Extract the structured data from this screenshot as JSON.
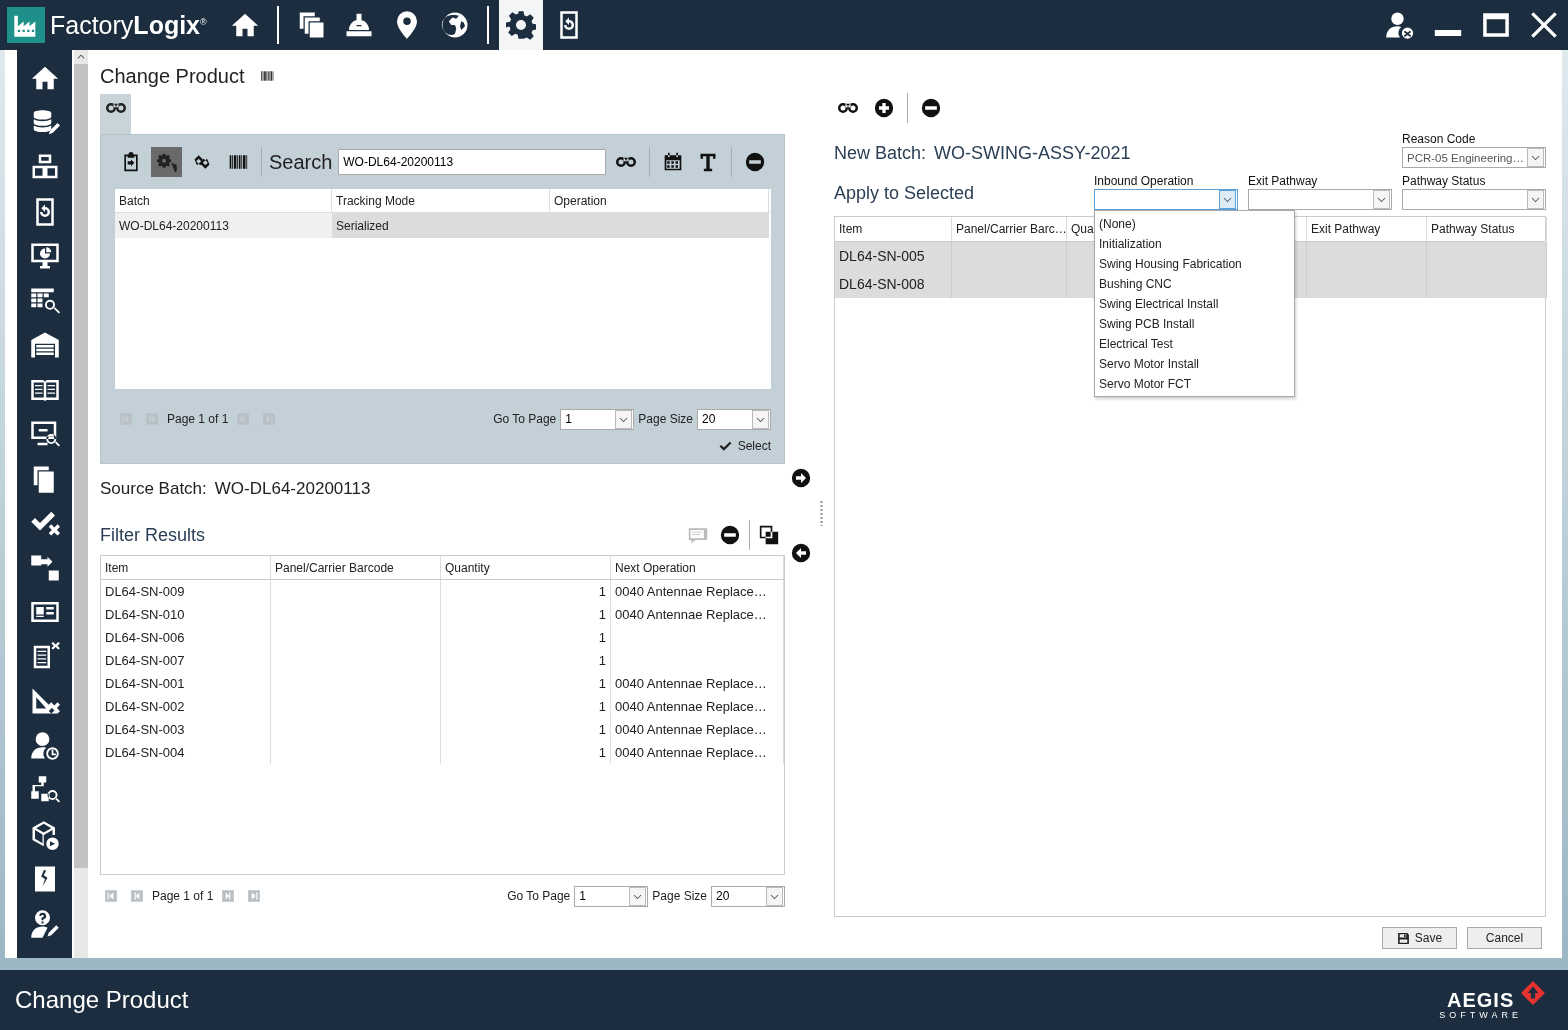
{
  "app": {
    "name": "Factory**Logix**$^{®}$"
  },
  "top_nav": [
    {
      "selected": false
    },
    {
      "selected": false
    },
    {
      "selected": false
    },
    {
      "selected": false
    },
    {
      "selected": false
    },
    {
      "selected": true
    },
    {
      "selected": false
    }
  ],
  "page": {
    "title": "Change Product"
  },
  "batch_search": {
    "tab": {
      "selected": true
    },
    "tools": [
      {
        "selected": false
      },
      {
        "selected": true
      },
      {
        "selected": false
      },
      {
        "selected": false
      }
    ],
    "search_label": "Search",
    "search_value": "WO-DL64-20200113",
    "columns": [
      "Batch",
      "Tracking Mode",
      "Operation"
    ],
    "rows": [
      {
        "cells": [
          "WO-DL64-20200113",
          "Serialized"
        ],
        "selected": true
      }
    ],
    "pager": {
      "page_info": "Page 1 of 1",
      "go_to_label": "Go To Page",
      "go_to_value": "1",
      "size_label": "Page Size",
      "size_value": "20"
    },
    "select_button": "Select"
  },
  "source": {
    "label": "Source Batch:",
    "value": "WO-DL64-20200113",
    "filter_title": "Filter Results",
    "columns": [
      "Item",
      "Panel/Carrier Barcode",
      "Quantity",
      "Next Operation"
    ],
    "rows": [
      {
        "item": "DL64-SN-009",
        "quantity": "1",
        "next_operation": "0040 Antennae Replace…"
      },
      {
        "item": "DL64-SN-010",
        "quantity": "1",
        "next_operation": "0040 Antennae Replace…"
      },
      {
        "item": "DL64-SN-006",
        "quantity": "1"
      },
      {
        "item": "DL64-SN-007",
        "quantity": "1"
      },
      {
        "item": "DL64-SN-001",
        "quantity": "1",
        "next_operation": "0040 Antennae Replace…"
      },
      {
        "item": "DL64-SN-002",
        "quantity": "1",
        "next_operation": "0040 Antennae Replace…"
      },
      {
        "item": "DL64-SN-003",
        "quantity": "1",
        "next_operation": "0040 Antennae Replace…"
      },
      {
        "item": "DL64-SN-004",
        "quantity": "1",
        "next_operation": "0040 Antennae Replace…"
      }
    ],
    "pager": {
      "page_info": "Page 1 of 1",
      "go_to_label": "Go To Page",
      "go_to_value": "1",
      "size_label": "Page Size",
      "size_value": "20"
    }
  },
  "new_batch": {
    "label": "New Batch:",
    "value": "WO-SWING-ASSY-2021",
    "reason_code": {
      "label": "Reason Code",
      "value": "PCR-05 Engineering…"
    },
    "apply_title": "Apply to Selected",
    "fields": [
      {
        "label": "Inbound Operation",
        "expanded": true,
        "options": [
          "(None)",
          "Initialization",
          "Swing Housing Fabrication",
          "Bushing CNC",
          "Swing Electrical Install",
          "Swing PCB Install",
          "Electrical Test",
          "Servo Motor Install",
          "Servo Motor FCT"
        ]
      },
      {
        "label": "Exit Pathway",
        "expanded": false
      },
      {
        "label": "Pathway Status",
        "expanded": false
      }
    ],
    "columns": [
      "Item",
      "Panel/Carrier Barc…",
      "Qua",
      "Exit Pathway",
      "Pathway Status"
    ],
    "rows": [
      {
        "item": "DL64-SN-005",
        "selected": true
      },
      {
        "item": "DL64-SN-008",
        "selected": true
      }
    ]
  },
  "buttons": {
    "save": "Save",
    "cancel": "Cancel"
  },
  "footer": {
    "title": "Change Product",
    "brand": "AEGIS",
    "brand_sub": "SOFTWARE"
  }
}
